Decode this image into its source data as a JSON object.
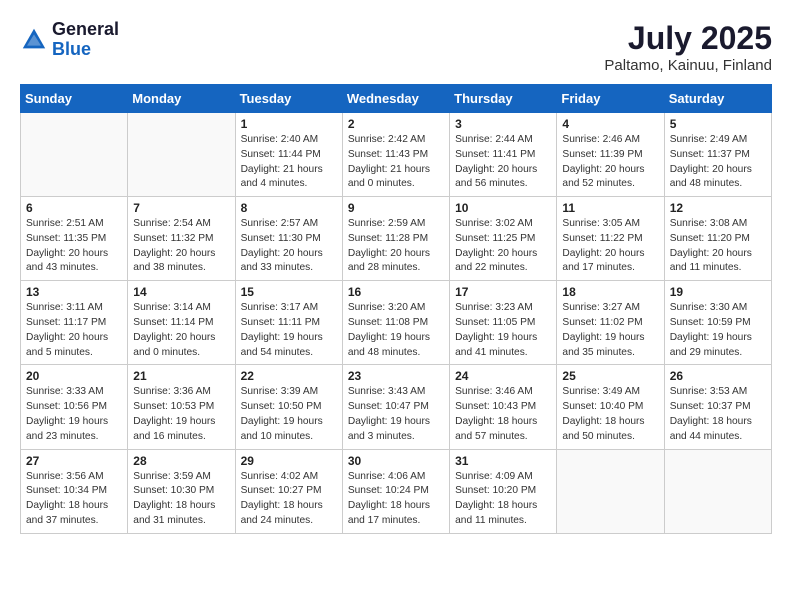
{
  "header": {
    "logo_general": "General",
    "logo_blue": "Blue",
    "month_year": "July 2025",
    "location": "Paltamo, Kainuu, Finland"
  },
  "weekdays": [
    "Sunday",
    "Monday",
    "Tuesday",
    "Wednesday",
    "Thursday",
    "Friday",
    "Saturday"
  ],
  "weeks": [
    [
      {
        "day": "",
        "info": ""
      },
      {
        "day": "",
        "info": ""
      },
      {
        "day": "1",
        "info": "Sunrise: 2:40 AM\nSunset: 11:44 PM\nDaylight: 21 hours\nand 4 minutes."
      },
      {
        "day": "2",
        "info": "Sunrise: 2:42 AM\nSunset: 11:43 PM\nDaylight: 21 hours\nand 0 minutes."
      },
      {
        "day": "3",
        "info": "Sunrise: 2:44 AM\nSunset: 11:41 PM\nDaylight: 20 hours\nand 56 minutes."
      },
      {
        "day": "4",
        "info": "Sunrise: 2:46 AM\nSunset: 11:39 PM\nDaylight: 20 hours\nand 52 minutes."
      },
      {
        "day": "5",
        "info": "Sunrise: 2:49 AM\nSunset: 11:37 PM\nDaylight: 20 hours\nand 48 minutes."
      }
    ],
    [
      {
        "day": "6",
        "info": "Sunrise: 2:51 AM\nSunset: 11:35 PM\nDaylight: 20 hours\nand 43 minutes."
      },
      {
        "day": "7",
        "info": "Sunrise: 2:54 AM\nSunset: 11:32 PM\nDaylight: 20 hours\nand 38 minutes."
      },
      {
        "day": "8",
        "info": "Sunrise: 2:57 AM\nSunset: 11:30 PM\nDaylight: 20 hours\nand 33 minutes."
      },
      {
        "day": "9",
        "info": "Sunrise: 2:59 AM\nSunset: 11:28 PM\nDaylight: 20 hours\nand 28 minutes."
      },
      {
        "day": "10",
        "info": "Sunrise: 3:02 AM\nSunset: 11:25 PM\nDaylight: 20 hours\nand 22 minutes."
      },
      {
        "day": "11",
        "info": "Sunrise: 3:05 AM\nSunset: 11:22 PM\nDaylight: 20 hours\nand 17 minutes."
      },
      {
        "day": "12",
        "info": "Sunrise: 3:08 AM\nSunset: 11:20 PM\nDaylight: 20 hours\nand 11 minutes."
      }
    ],
    [
      {
        "day": "13",
        "info": "Sunrise: 3:11 AM\nSunset: 11:17 PM\nDaylight: 20 hours\nand 5 minutes."
      },
      {
        "day": "14",
        "info": "Sunrise: 3:14 AM\nSunset: 11:14 PM\nDaylight: 20 hours\nand 0 minutes."
      },
      {
        "day": "15",
        "info": "Sunrise: 3:17 AM\nSunset: 11:11 PM\nDaylight: 19 hours\nand 54 minutes."
      },
      {
        "day": "16",
        "info": "Sunrise: 3:20 AM\nSunset: 11:08 PM\nDaylight: 19 hours\nand 48 minutes."
      },
      {
        "day": "17",
        "info": "Sunrise: 3:23 AM\nSunset: 11:05 PM\nDaylight: 19 hours\nand 41 minutes."
      },
      {
        "day": "18",
        "info": "Sunrise: 3:27 AM\nSunset: 11:02 PM\nDaylight: 19 hours\nand 35 minutes."
      },
      {
        "day": "19",
        "info": "Sunrise: 3:30 AM\nSunset: 10:59 PM\nDaylight: 19 hours\nand 29 minutes."
      }
    ],
    [
      {
        "day": "20",
        "info": "Sunrise: 3:33 AM\nSunset: 10:56 PM\nDaylight: 19 hours\nand 23 minutes."
      },
      {
        "day": "21",
        "info": "Sunrise: 3:36 AM\nSunset: 10:53 PM\nDaylight: 19 hours\nand 16 minutes."
      },
      {
        "day": "22",
        "info": "Sunrise: 3:39 AM\nSunset: 10:50 PM\nDaylight: 19 hours\nand 10 minutes."
      },
      {
        "day": "23",
        "info": "Sunrise: 3:43 AM\nSunset: 10:47 PM\nDaylight: 19 hours\nand 3 minutes."
      },
      {
        "day": "24",
        "info": "Sunrise: 3:46 AM\nSunset: 10:43 PM\nDaylight: 18 hours\nand 57 minutes."
      },
      {
        "day": "25",
        "info": "Sunrise: 3:49 AM\nSunset: 10:40 PM\nDaylight: 18 hours\nand 50 minutes."
      },
      {
        "day": "26",
        "info": "Sunrise: 3:53 AM\nSunset: 10:37 PM\nDaylight: 18 hours\nand 44 minutes."
      }
    ],
    [
      {
        "day": "27",
        "info": "Sunrise: 3:56 AM\nSunset: 10:34 PM\nDaylight: 18 hours\nand 37 minutes."
      },
      {
        "day": "28",
        "info": "Sunrise: 3:59 AM\nSunset: 10:30 PM\nDaylight: 18 hours\nand 31 minutes."
      },
      {
        "day": "29",
        "info": "Sunrise: 4:02 AM\nSunset: 10:27 PM\nDaylight: 18 hours\nand 24 minutes."
      },
      {
        "day": "30",
        "info": "Sunrise: 4:06 AM\nSunset: 10:24 PM\nDaylight: 18 hours\nand 17 minutes."
      },
      {
        "day": "31",
        "info": "Sunrise: 4:09 AM\nSunset: 10:20 PM\nDaylight: 18 hours\nand 11 minutes."
      },
      {
        "day": "",
        "info": ""
      },
      {
        "day": "",
        "info": ""
      }
    ]
  ]
}
